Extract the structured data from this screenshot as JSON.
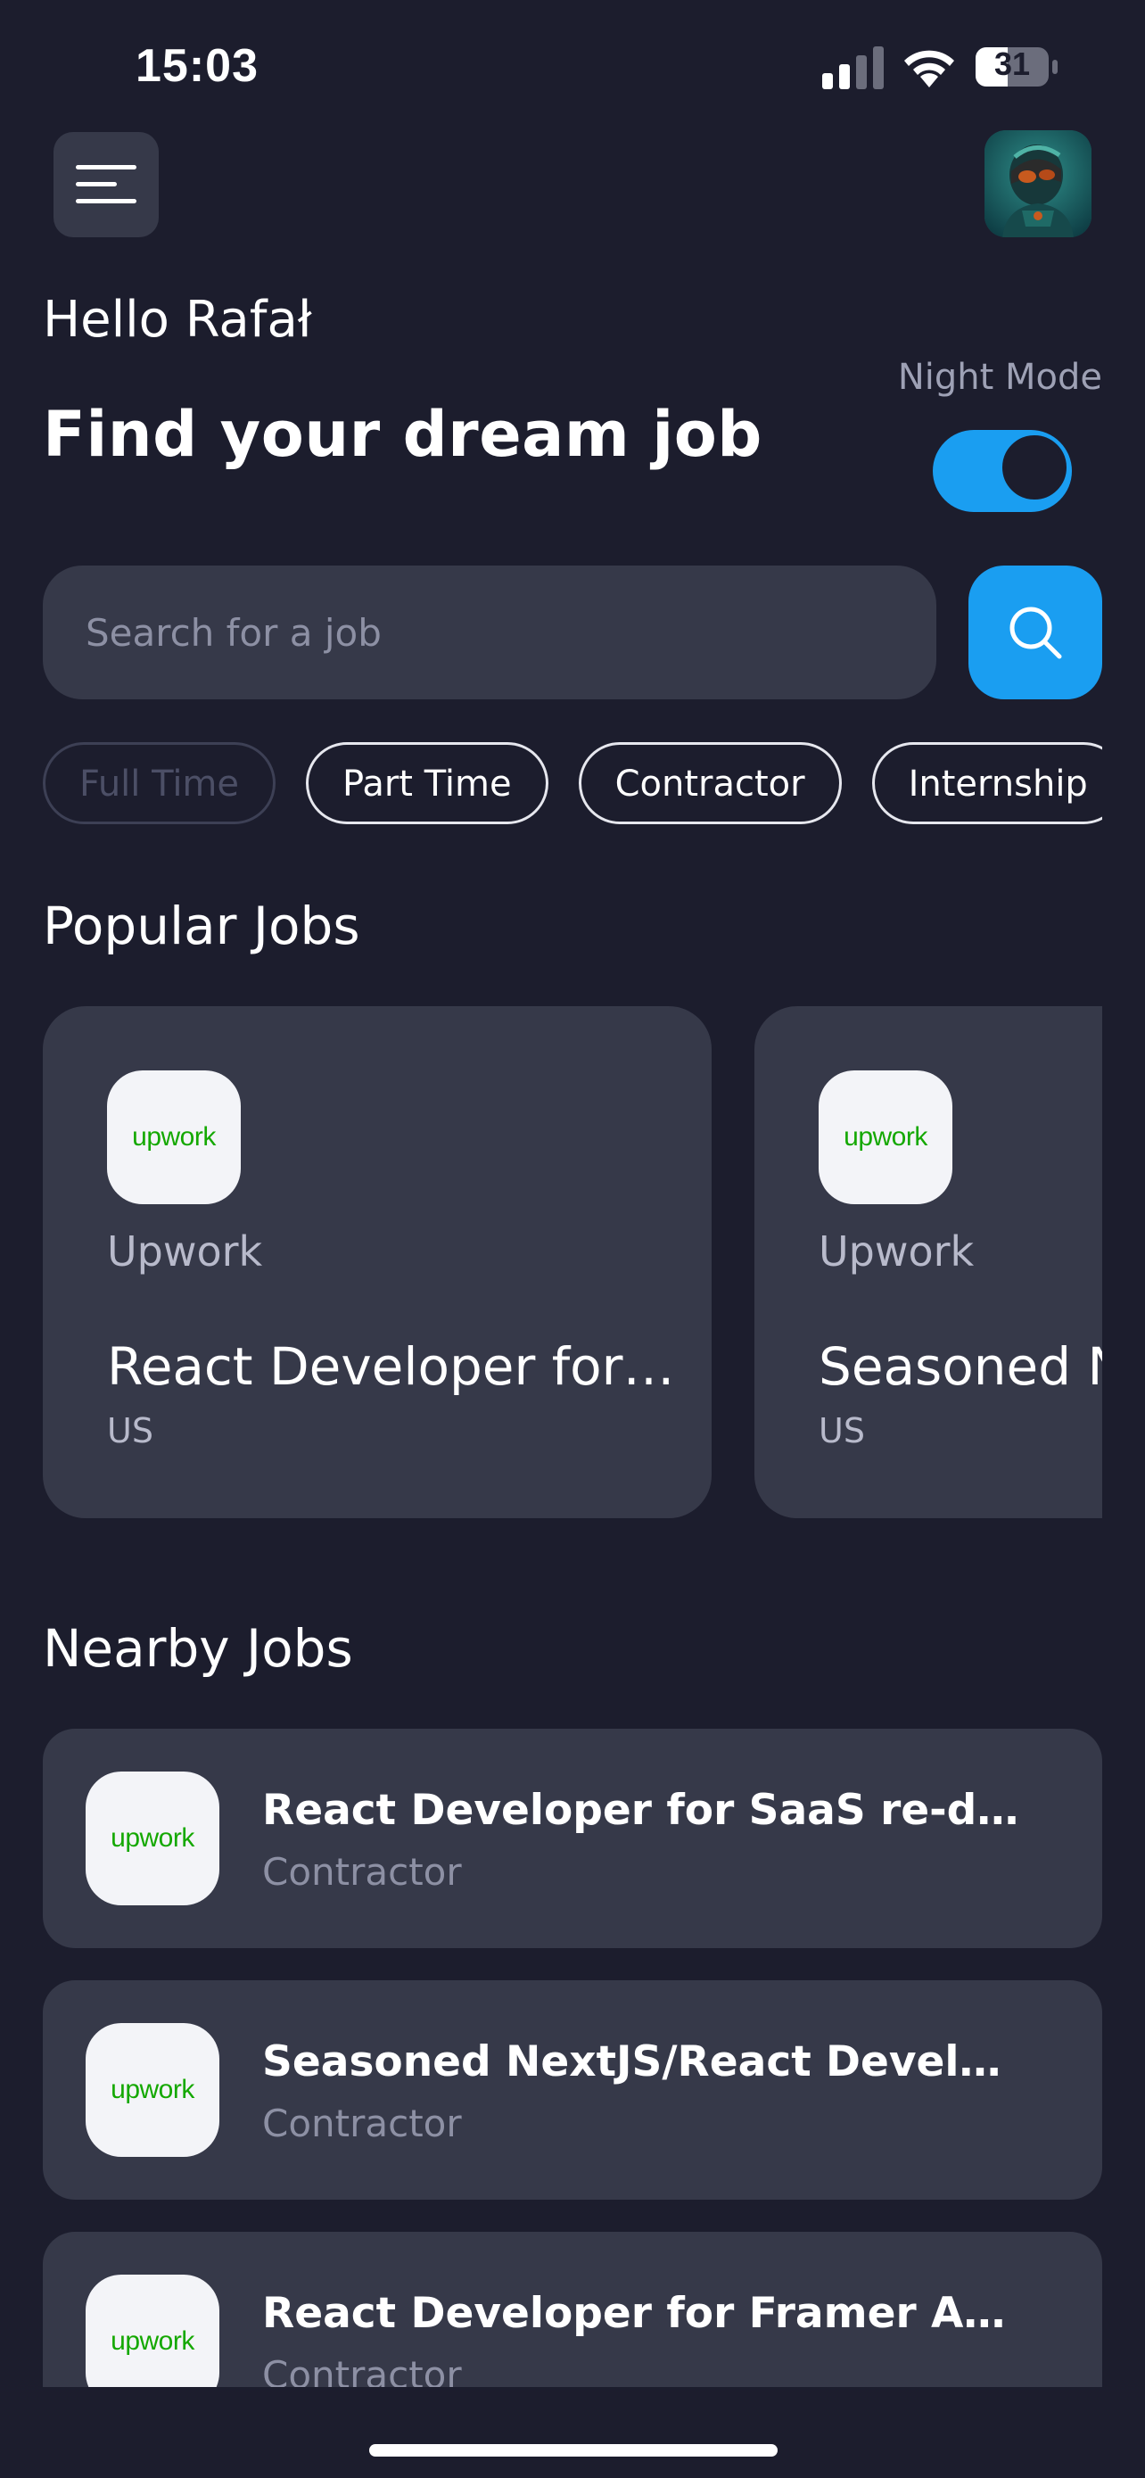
{
  "status_bar": {
    "time": "15:03",
    "battery": "31",
    "icons": [
      "signal-icon",
      "wifi-icon",
      "battery-icon"
    ]
  },
  "header": {
    "menu_icon": "hamburger-menu-icon",
    "avatar": "robot-avatar"
  },
  "greeting": "Hello Rafał",
  "headline": "Find your dream job",
  "night_mode": {
    "label": "Night Mode",
    "enabled": true
  },
  "search": {
    "placeholder": "Search for a job",
    "value": "",
    "button_icon": "search-icon"
  },
  "filters": [
    {
      "label": "Full Time",
      "active": false
    },
    {
      "label": "Part Time",
      "active": true
    },
    {
      "label": "Contractor",
      "active": true
    },
    {
      "label": "Internship",
      "active": true
    }
  ],
  "popular": {
    "title": "Popular Jobs",
    "jobs": [
      {
        "logo": "upwork",
        "company": "Upwork",
        "title": "React Developer for SaaS re-development",
        "location": "US"
      },
      {
        "logo": "upwork",
        "company": "Upwork",
        "title": "Seasoned NextJS/React Developer",
        "location": "US"
      }
    ]
  },
  "nearby": {
    "title": "Nearby Jobs",
    "jobs": [
      {
        "logo": "upwork",
        "title": "React Developer for SaaS re-development",
        "type": "Contractor"
      },
      {
        "logo": "upwork",
        "title": "Seasoned NextJS/React Developer needed",
        "type": "Contractor"
      },
      {
        "logo": "upwork",
        "title": "React Developer for Framer App - long term",
        "type": "Contractor"
      }
    ]
  },
  "colors": {
    "background": "#1c1d2d",
    "card": "#363949",
    "accent": "#1a9ef1",
    "muted_text": "#8d90a4",
    "upwork_green": "#14a800"
  }
}
